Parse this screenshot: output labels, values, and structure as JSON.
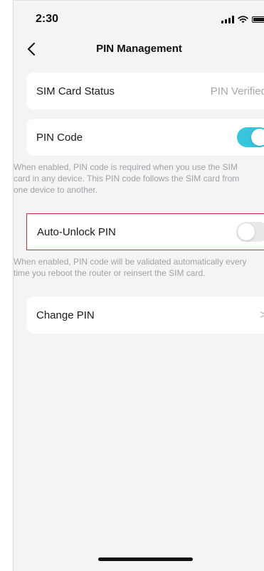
{
  "status_bar": {
    "time": "2:30"
  },
  "nav": {
    "title": "PIN Management"
  },
  "sim_card_status": {
    "label": "SIM Card Status",
    "value": "PIN Verified"
  },
  "pin_code": {
    "label": "PIN Code",
    "enabled": true,
    "description": "When enabled, PIN code is required when you use the SIM card in any device. This PIN code follows the SIM card from one device to another."
  },
  "auto_unlock_pin": {
    "label": "Auto-Unlock PIN",
    "enabled": false,
    "description": "When enabled, PIN code will be validated automatically every time you reboot the router or reinsert the SIM card."
  },
  "change_pin": {
    "label": "Change PIN"
  },
  "colors": {
    "accent": "#35c5dc",
    "highlight_border": "#c8303a",
    "background": "#f4f4f6"
  }
}
